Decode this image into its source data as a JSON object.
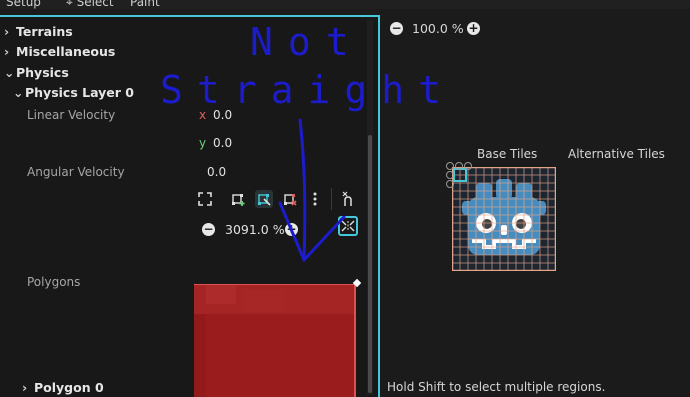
{
  "top_tabs": {
    "setup": "Setup",
    "select": "Select",
    "paint": "Paint"
  },
  "tree": {
    "terrains": "Terrains",
    "miscellaneous": "Miscellaneous",
    "physics": "Physics",
    "physics_layer": "Physics Layer 0",
    "polygon": "Polygon 0"
  },
  "properties": {
    "linear_velocity": {
      "label": "Linear Velocity",
      "x_axis": "x",
      "x": "0.0",
      "y_axis": "y",
      "y": "0.0"
    },
    "angular_velocity": {
      "label": "Angular Velocity",
      "value": "0.0"
    },
    "polygons": {
      "label": "Polygons"
    }
  },
  "polygon_editor": {
    "zoom": "3091.0 %",
    "toolbar_icons": [
      "expand-icon",
      "add-point-icon",
      "edit-points-icon",
      "delete-points-icon",
      "more-icon",
      "snap-icon"
    ],
    "reset_view_icon": "center-view-icon"
  },
  "tile_view": {
    "zoom": "100.0 %",
    "base_tiles": "Base Tiles",
    "alternative_tiles": "Alternative Tiles",
    "status": "Hold Shift to select multiple regions."
  },
  "annotation": {
    "line1": "Not",
    "line2": "Straight"
  },
  "colors": {
    "accent": "#45c8da",
    "polygon_fill": "#9b1c1c",
    "annotation": "#1c1ccc",
    "godot_blue": "#478cbf"
  }
}
